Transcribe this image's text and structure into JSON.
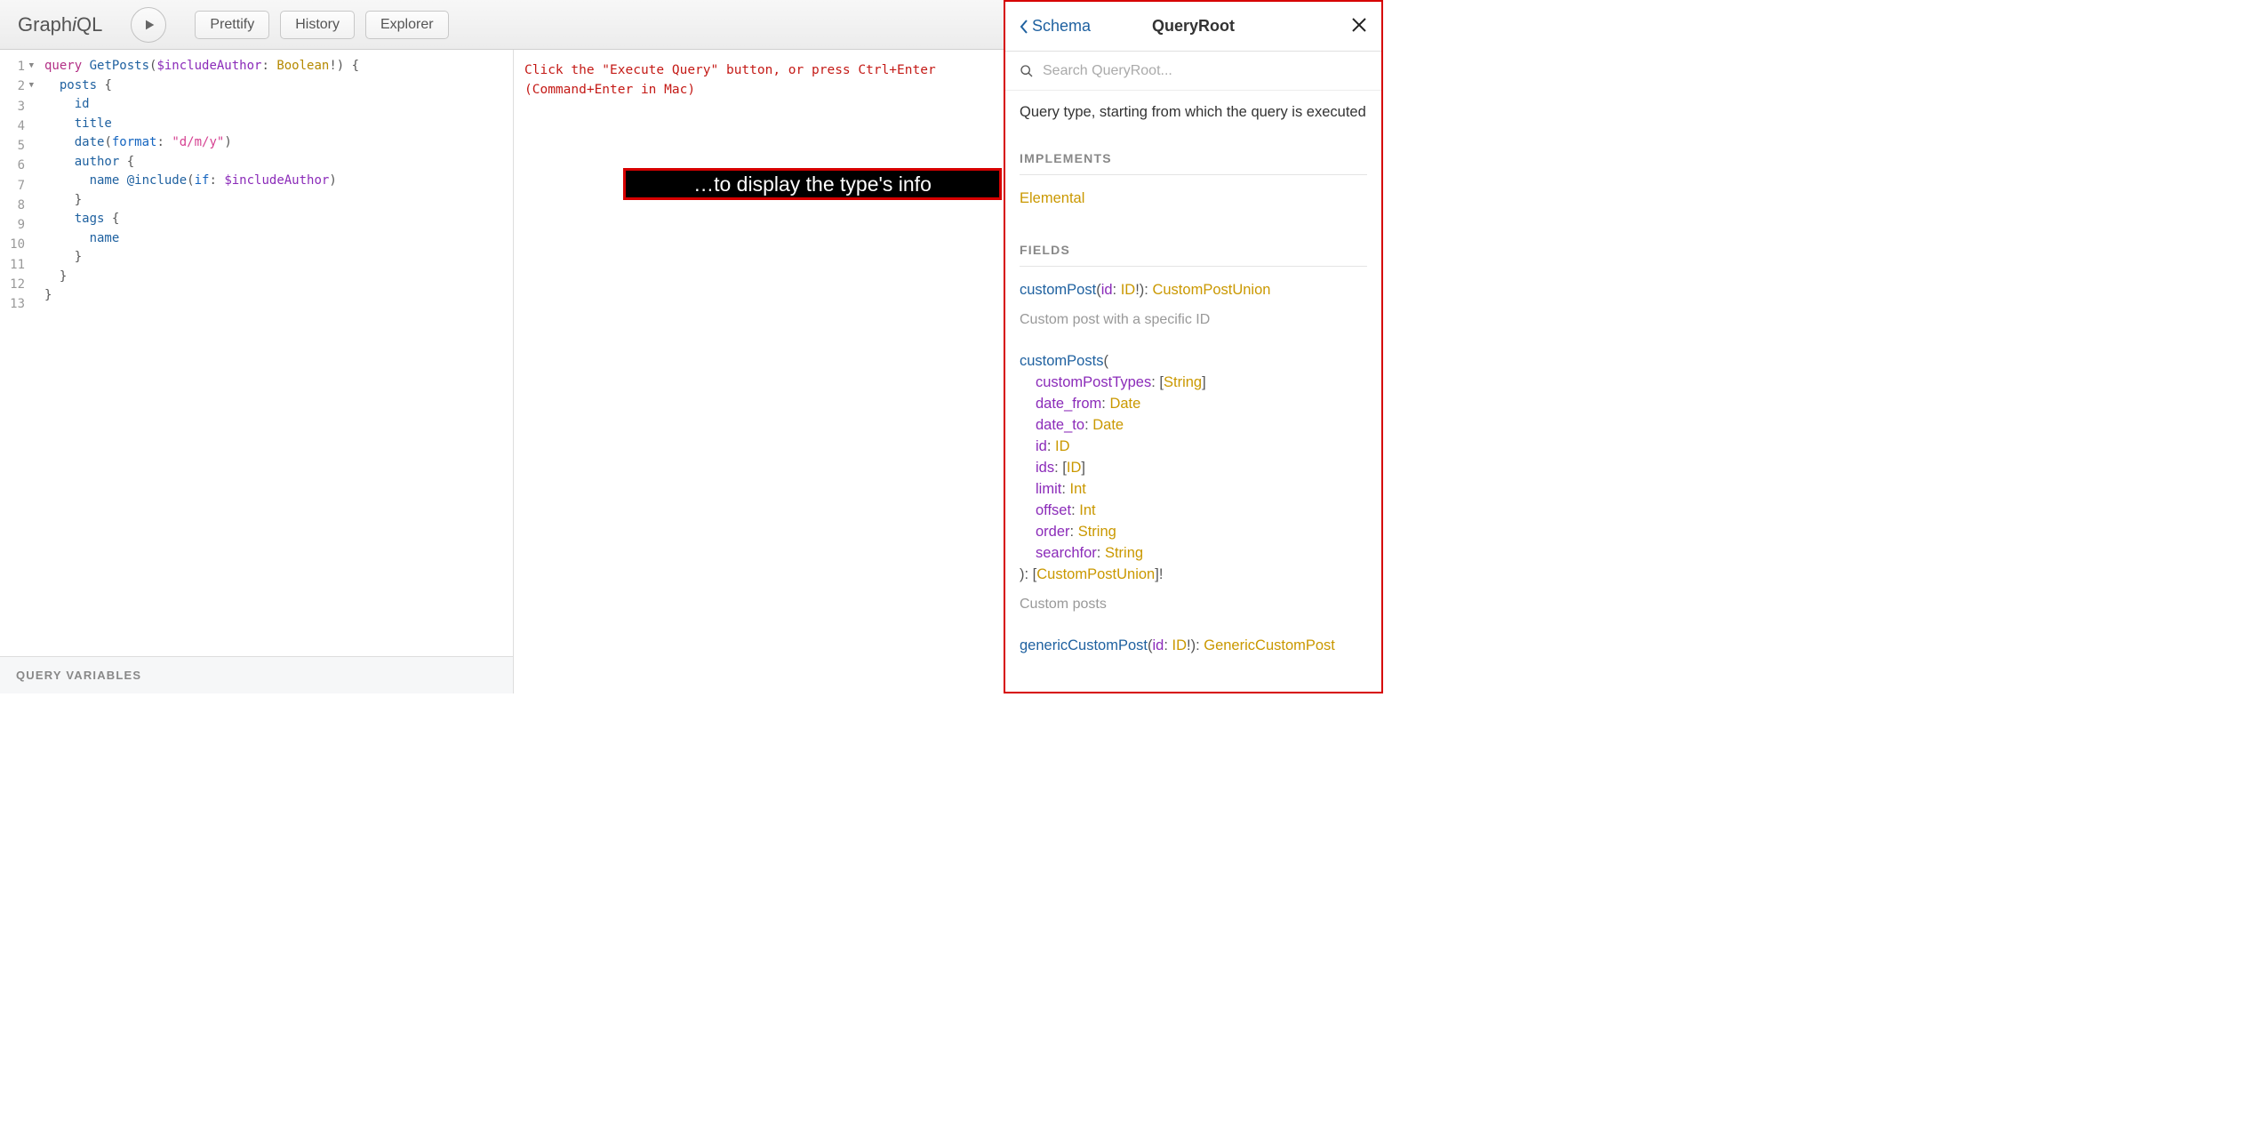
{
  "app": {
    "logo_graph": "Graph",
    "logo_i": "i",
    "logo_ql": "QL"
  },
  "toolbar": {
    "prettify": "Prettify",
    "history": "History",
    "explorer": "Explorer"
  },
  "editor": {
    "lines": [
      1,
      2,
      3,
      4,
      5,
      6,
      7,
      8,
      9,
      10,
      11,
      12,
      13
    ],
    "query_variables_label": "QUERY VARIABLES",
    "code_tokens": {
      "l1_kw": "query",
      "l1_def": " GetPosts",
      "l1_p1": "(",
      "l1_var": "$includeAuthor",
      "l1_p2": ": ",
      "l1_type": "Boolean",
      "l1_bang": "!",
      "l1_p3": ") {",
      "l2_def": "posts",
      "l2_p": " {",
      "l3_prop": "id",
      "l4_prop": "title",
      "l5_prop": "date",
      "l5_p1": "(",
      "l5_arg": "format",
      "l5_p2": ": ",
      "l5_str": "\"d/m/y\"",
      "l5_p3": ")",
      "l6_prop": "author",
      "l6_p": " {",
      "l7_prop": "name",
      "l7_sp": " ",
      "l7_dir": "@include",
      "l7_p1": "(",
      "l7_arg": "if",
      "l7_p2": ": ",
      "l7_var": "$includeAuthor",
      "l7_p3": ")",
      "l8_p": "}",
      "l9_prop": "tags",
      "l9_p": " {",
      "l10_prop": "name",
      "l11_p": "}",
      "l12_p": "}",
      "l13_p": "}"
    }
  },
  "result": {
    "line1": "Click the \"Execute Query\" button, or press Ctrl+Enter",
    "line2": "(Command+Enter in Mac)"
  },
  "overlay": {
    "text": "…to display the type's info"
  },
  "docs": {
    "back_label": "Schema",
    "title": "QueryRoot",
    "search_placeholder": "Search QueryRoot...",
    "description": "Query type, starting from which the query is executed",
    "implements_label": "IMPLEMENTS",
    "implements_value": "Elemental",
    "fields_label": "FIELDS",
    "fields": {
      "customPost": {
        "name": "customPost",
        "arg_name": "id",
        "arg_type": "ID",
        "return": "CustomPostUnion",
        "desc": "Custom post with a specific ID"
      },
      "customPosts": {
        "name": "customPosts",
        "args": [
          {
            "name": "customPostTypes",
            "type": "String",
            "list": true
          },
          {
            "name": "date_from",
            "type": "Date"
          },
          {
            "name": "date_to",
            "type": "Date"
          },
          {
            "name": "id",
            "type": "ID"
          },
          {
            "name": "ids",
            "type": "ID",
            "list": true
          },
          {
            "name": "limit",
            "type": "Int"
          },
          {
            "name": "offset",
            "type": "Int"
          },
          {
            "name": "order",
            "type": "String"
          },
          {
            "name": "searchfor",
            "type": "String"
          }
        ],
        "return": "CustomPostUnion",
        "return_list": true,
        "return_nonnull": true,
        "desc": "Custom posts"
      },
      "genericCustomPost": {
        "name": "genericCustomPost",
        "arg_name": "id",
        "arg_type": "ID",
        "return": "GenericCustomPost"
      }
    }
  }
}
